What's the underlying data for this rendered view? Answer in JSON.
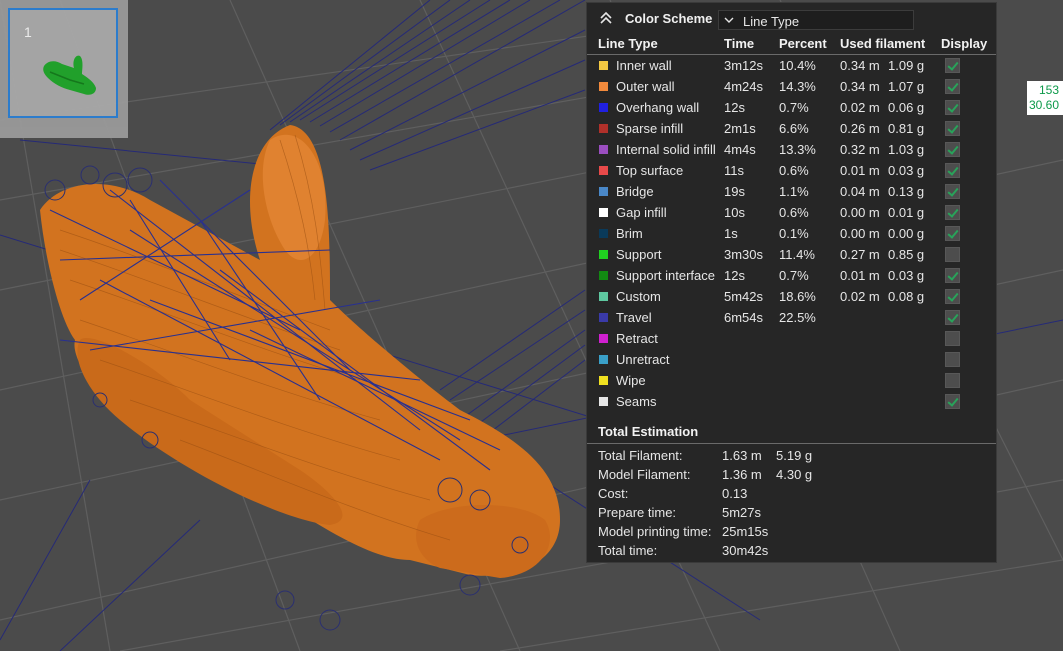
{
  "thumbnail": {
    "index": "1"
  },
  "readout": {
    "line1": "153",
    "line2": "30.60"
  },
  "panel": {
    "scheme_label": "Color Scheme",
    "scheme_value": "Line Type",
    "headers": [
      "Line Type",
      "Time",
      "Percent",
      "Used filament",
      "Display"
    ],
    "rows": [
      {
        "name": "Inner wall",
        "time": "3m12s",
        "percent": "10.4%",
        "length": "0.34 m",
        "weight": "1.09 g",
        "color": "#f4c842",
        "display": true
      },
      {
        "name": "Outer wall",
        "time": "4m24s",
        "percent": "14.3%",
        "length": "0.34 m",
        "weight": "1.07 g",
        "color": "#f28a3c",
        "display": true
      },
      {
        "name": "Overhang wall",
        "time": "12s",
        "percent": "0.7%",
        "length": "0.02 m",
        "weight": "0.06 g",
        "color": "#2020e0",
        "display": true
      },
      {
        "name": "Sparse infill",
        "time": "2m1s",
        "percent": "6.6%",
        "length": "0.26 m",
        "weight": "0.81 g",
        "color": "#b0302a",
        "display": true
      },
      {
        "name": "Internal solid infill",
        "time": "4m4s",
        "percent": "13.3%",
        "length": "0.32 m",
        "weight": "1.03 g",
        "color": "#9b4ec0",
        "display": true
      },
      {
        "name": "Top surface",
        "time": "11s",
        "percent": "0.6%",
        "length": "0.01 m",
        "weight": "0.03 g",
        "color": "#e84a4a",
        "display": true
      },
      {
        "name": "Bridge",
        "time": "19s",
        "percent": "1.1%",
        "length": "0.04 m",
        "weight": "0.13 g",
        "color": "#4a88c8",
        "display": true
      },
      {
        "name": "Gap infill",
        "time": "10s",
        "percent": "0.6%",
        "length": "0.00 m",
        "weight": "0.01 g",
        "color": "#ffffff",
        "display": true
      },
      {
        "name": "Brim",
        "time": "1s",
        "percent": "0.1%",
        "length": "0.00 m",
        "weight": "0.00 g",
        "color": "#0a3a5a",
        "display": true
      },
      {
        "name": "Support",
        "time": "3m30s",
        "percent": "11.4%",
        "length": "0.27 m",
        "weight": "0.85 g",
        "color": "#20d020",
        "display": false
      },
      {
        "name": "Support interface",
        "time": "12s",
        "percent": "0.7%",
        "length": "0.01 m",
        "weight": "0.03 g",
        "color": "#128a12",
        "display": true
      },
      {
        "name": "Custom",
        "time": "5m42s",
        "percent": "18.6%",
        "length": "0.02 m",
        "weight": "0.08 g",
        "color": "#5ec8a0",
        "display": true
      },
      {
        "name": "Travel",
        "time": "6m54s",
        "percent": "22.5%",
        "length": "",
        "weight": "",
        "color": "#3a3aa8",
        "display": true
      },
      {
        "name": "Retract",
        "time": "",
        "percent": "",
        "length": "",
        "weight": "",
        "color": "#d020d0",
        "display": false
      },
      {
        "name": "Unretract",
        "time": "",
        "percent": "",
        "length": "",
        "weight": "",
        "color": "#3aa0c8",
        "display": false
      },
      {
        "name": "Wipe",
        "time": "",
        "percent": "",
        "length": "",
        "weight": "",
        "color": "#f0e020",
        "display": false
      },
      {
        "name": "Seams",
        "time": "",
        "percent": "",
        "length": "",
        "weight": "",
        "color": "#e6e6e6",
        "display": true
      }
    ],
    "total_title": "Total Estimation",
    "totals": [
      {
        "label": "Total Filament:",
        "v1": "1.63 m",
        "v2": "5.19 g"
      },
      {
        "label": "Model Filament:",
        "v1": "1.36 m",
        "v2": "4.30 g"
      },
      {
        "label": "Cost:",
        "v1": "0.13",
        "v2": ""
      },
      {
        "label": "Prepare time:",
        "v1": "5m27s",
        "v2": ""
      },
      {
        "label": "Model printing time:",
        "v1": "25m15s",
        "v2": ""
      },
      {
        "label": "Total time:",
        "v1": "30m42s",
        "v2": ""
      }
    ]
  },
  "colors": {
    "background": "#4a4a4a",
    "grid": "#5a5a5a",
    "model": "#d2731f",
    "travel": "#23287a",
    "panel": "#262626",
    "check": "#29a35a"
  }
}
